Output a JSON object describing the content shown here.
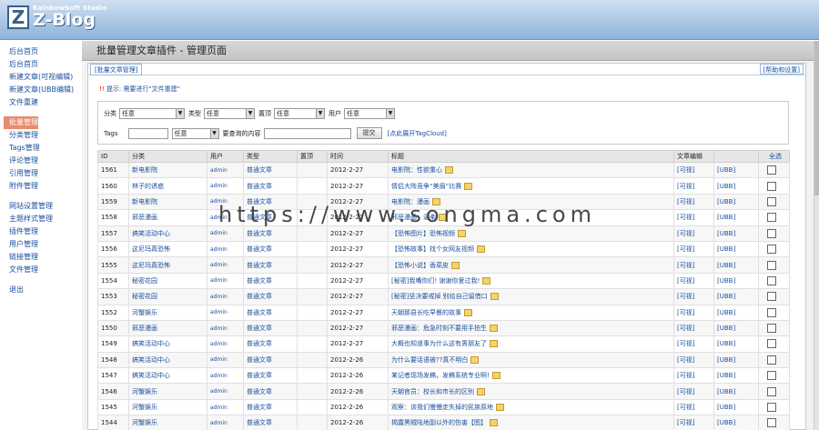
{
  "header": {
    "studio": "RainbowSoft Studio",
    "app_name": "Z-Blog"
  },
  "sidebar": {
    "items": [
      {
        "label": "后台首页",
        "group": 1
      },
      {
        "label": "后台首页",
        "group": 1
      },
      {
        "label": "新建文章(可视编辑)",
        "group": 1
      },
      {
        "label": "新建文章(UBB编辑)",
        "group": 1
      },
      {
        "label": "文件重建",
        "group": 1
      }
    ],
    "group2": [
      {
        "label": "批量管理",
        "active": true
      },
      {
        "label": "分类管理"
      },
      {
        "label": "Tags管理"
      },
      {
        "label": "评论管理"
      },
      {
        "label": "引用管理"
      },
      {
        "label": "附件管理"
      }
    ],
    "group3": [
      {
        "label": "网站设置管理"
      },
      {
        "label": "主题样式管理"
      },
      {
        "label": "插件管理"
      },
      {
        "label": "用户管理"
      },
      {
        "label": "链接管理"
      },
      {
        "label": "文件管理"
      }
    ],
    "logout": "退出"
  },
  "page": {
    "title": "批量管理文章插件 - 管理页面",
    "tab": "[批量文章管理]",
    "help": "[帮助和设置]",
    "tip_bang": "!!",
    "tip": "提示: 需要进行\"文件重建\""
  },
  "filter": {
    "category_label": "分类",
    "category_value": "任意",
    "type_label": "类型",
    "type_value": "任意",
    "top_label": "置顶",
    "top_value": "任意",
    "user_label": "用户",
    "user_value": "任意",
    "tags_label": "Tags",
    "tags_select": "任意",
    "content_label": "要查询的内容",
    "submit_label": "提交",
    "tagcloud_link": "[点此展开TagCloud]"
  },
  "table": {
    "headers": [
      "ID",
      "分类",
      "用户",
      "类型",
      "置顶",
      "时间",
      "标题",
      "文章编辑",
      "",
      "全选"
    ],
    "view_label": "[可视]",
    "ubb_label": "[UBB]",
    "rows": [
      {
        "id": "1561",
        "cat": "新电影院",
        "user": "admin",
        "type": "普通文章",
        "top": "",
        "time": "2012-2-27",
        "title": "电影院：性欲重心"
      },
      {
        "id": "1560",
        "cat": "林子的诱惑",
        "user": "admin",
        "type": "普通文章",
        "top": "",
        "time": "2012-2-27",
        "title": "情侣大阵竞争“美眉”比赛"
      },
      {
        "id": "1559",
        "cat": "新电影院",
        "user": "admin",
        "type": "普通文章",
        "top": "",
        "time": "2012-2-27",
        "title": "电影院：漫画"
      },
      {
        "id": "1558",
        "cat": "邪恶漫画",
        "user": "admin",
        "type": "普通文章",
        "top": "",
        "time": "2012-2-27",
        "title": "邪恶漫画：温柔"
      },
      {
        "id": "1557",
        "cat": "搞笑活动中心",
        "user": "admin",
        "type": "普通文章",
        "top": "",
        "time": "2012-2-27",
        "title": "【恐怖图片】恐怖视频"
      },
      {
        "id": "1556",
        "cat": "这尼玛真恐怖",
        "user": "admin",
        "type": "普通文章",
        "top": "",
        "time": "2012-2-27",
        "title": "【恐怖故事】找个女网友视频"
      },
      {
        "id": "1555",
        "cat": "这尼玛真恐怖",
        "user": "admin",
        "type": "普通文章",
        "top": "",
        "time": "2012-2-27",
        "title": "【恐怖小说】香菜皮"
      },
      {
        "id": "1554",
        "cat": "秘密花园",
        "user": "admin",
        "type": "普通文章",
        "top": "",
        "time": "2012-2-27",
        "title": "[秘密]我嘴你们! 谢谢你爱过我!"
      },
      {
        "id": "1553",
        "cat": "秘密花园",
        "user": "admin",
        "type": "普通文章",
        "top": "",
        "time": "2012-2-27",
        "title": "[秘密]坚决要戒掉 别给自己留借口"
      },
      {
        "id": "1552",
        "cat": "河蟹娱乐",
        "user": "admin",
        "type": "普通文章",
        "top": "",
        "time": "2012-2-27",
        "title": "天朝那县长吃早餐的故事"
      },
      {
        "id": "1550",
        "cat": "邪恶漫画",
        "user": "admin",
        "type": "普通文章",
        "top": "",
        "time": "2012-2-27",
        "title": "邪恶漫画：危急时刻不要用手拍生"
      },
      {
        "id": "1549",
        "cat": "搞笑活动中心",
        "user": "admin",
        "type": "普通文章",
        "top": "",
        "time": "2012-2-27",
        "title": "大概也知道事为什么这有男朋友了"
      },
      {
        "id": "1548",
        "cat": "搞笑活动中心",
        "user": "admin",
        "type": "普通文章",
        "top": "",
        "time": "2012-2-26",
        "title": "为什么要话语被??真不明白"
      },
      {
        "id": "1547",
        "cat": "搞笑活动中心",
        "user": "admin",
        "type": "普通文章",
        "top": "",
        "time": "2012-2-26",
        "title": "某记者现场发稿，发稿系统专业啊!"
      },
      {
        "id": "1546",
        "cat": "河蟹娱乐",
        "user": "admin",
        "type": "普通文章",
        "top": "",
        "time": "2012-2-26",
        "title": "天朝官员：校长和市长的区别"
      },
      {
        "id": "1545",
        "cat": "河蟹娱乐",
        "user": "admin",
        "type": "普通文章",
        "top": "",
        "time": "2012-2-26",
        "title": "观察：该我们慢慢走失掉的民族原地"
      },
      {
        "id": "1544",
        "cat": "河蟹娱乐",
        "user": "admin",
        "type": "普通文章",
        "top": "",
        "time": "2012-2-26",
        "title": "揭露黑贼陆地副以外的伤害【图】"
      }
    ]
  },
  "watermark": "https://www.songma.com"
}
